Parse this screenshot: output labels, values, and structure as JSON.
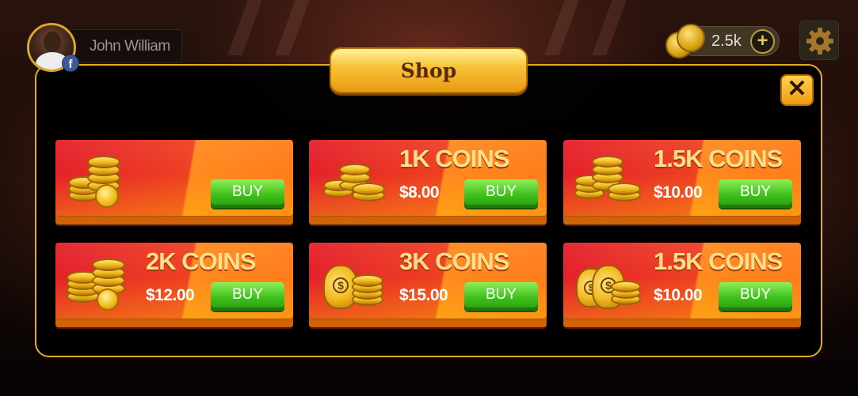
{
  "player": {
    "name": "John William",
    "avatar_icon": "user-avatar-icon",
    "badge_icon": "facebook-icon",
    "badge_text": "f"
  },
  "currency": {
    "balance": "2.5k",
    "coin_icon": "coin-stack-icon",
    "add_icon": "plus-icon",
    "add_label": "+"
  },
  "settings": {
    "icon": "gear-icon"
  },
  "shop": {
    "title": "Shop",
    "close_label": "✕",
    "items": [
      {
        "label": "",
        "price": "",
        "buy_label": "BUY",
        "art": "coin-pile-icon"
      },
      {
        "label": "1K COINS",
        "price": "$8.00",
        "buy_label": "BUY",
        "art": "coin-stack-icon"
      },
      {
        "label": "1.5K COINS",
        "price": "$10.00",
        "buy_label": "BUY",
        "art": "coin-stack-icon"
      },
      {
        "label": "2K COINS",
        "price": "$12.00",
        "buy_label": "BUY",
        "art": "coin-pile-icon"
      },
      {
        "label": "3K COINS",
        "price": "$15.00",
        "buy_label": "BUY",
        "art": "money-bag-icon"
      },
      {
        "label": "1.5K COINS",
        "price": "$10.00",
        "buy_label": "BUY",
        "art": "money-bags-icon"
      }
    ]
  },
  "colors": {
    "accent_gold": "#e6ad23",
    "card_red": "#e41f2a",
    "card_orange": "#ff8a1e",
    "buy_green": "#3fbf1c"
  }
}
